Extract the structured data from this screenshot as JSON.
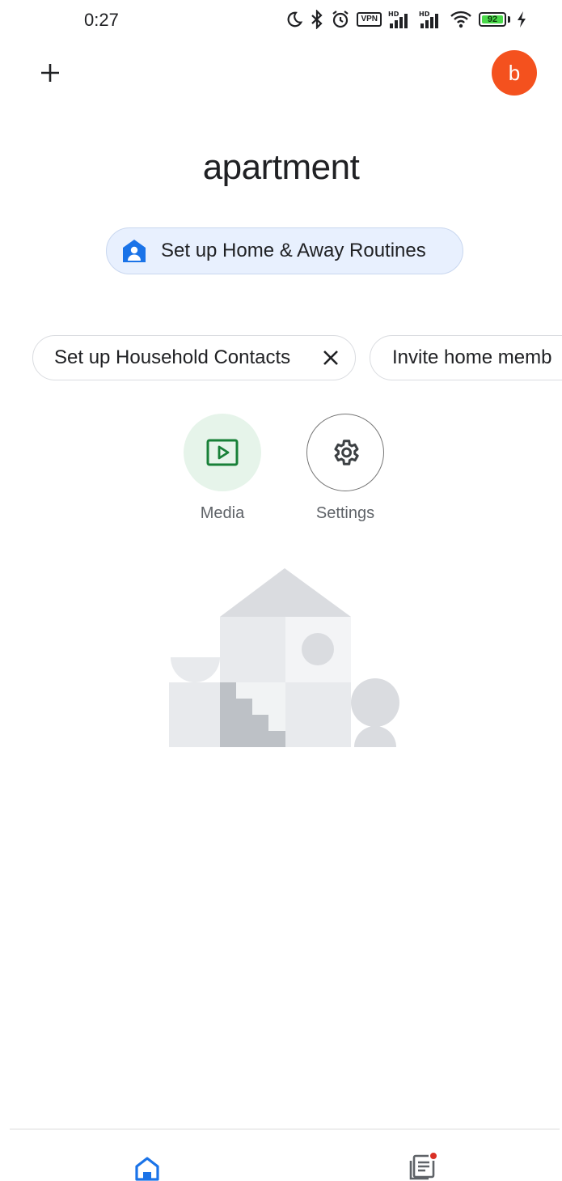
{
  "status_bar": {
    "time": "0:27",
    "vpn_label": "VPN",
    "battery_level": "92",
    "network_label_1": "HD",
    "network_label_2": "HD"
  },
  "header": {
    "avatar_initial": "b",
    "avatar_color": "#f4511e",
    "home_name": "apartment"
  },
  "routines_chip": {
    "label": "Set up Home & Away Routines"
  },
  "suggestion_chips": [
    {
      "label": "Set up Household Contacts"
    },
    {
      "label": "Invite home memb"
    }
  ],
  "shortcuts": [
    {
      "label": "Media",
      "icon": "media-play-icon"
    },
    {
      "label": "Settings",
      "icon": "gear-icon"
    }
  ],
  "bottom_nav": {
    "items": [
      {
        "icon": "home-icon",
        "active": true
      },
      {
        "icon": "feed-icon",
        "has_badge": true
      }
    ]
  },
  "colors": {
    "accent_blue": "#1a73e8",
    "media_green": "#188038",
    "badge_red": "#d93025"
  }
}
